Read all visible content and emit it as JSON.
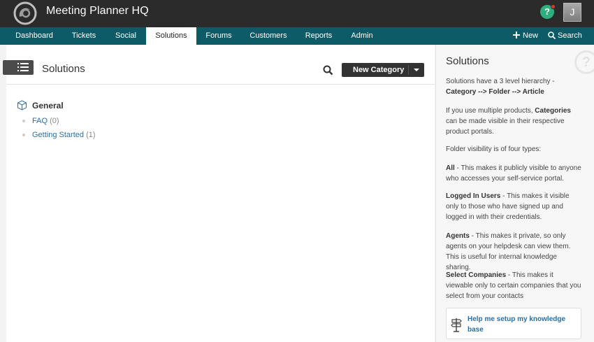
{
  "header": {
    "app_title": "Meeting Planner HQ",
    "help_label": "?",
    "avatar_initial": "J"
  },
  "nav": {
    "tabs": [
      {
        "label": "Dashboard"
      },
      {
        "label": "Tickets"
      },
      {
        "label": "Social"
      },
      {
        "label": "Solutions",
        "active": true
      },
      {
        "label": "Forums"
      },
      {
        "label": "Customers"
      },
      {
        "label": "Reports"
      },
      {
        "label": "Admin"
      }
    ],
    "new_label": "New",
    "search_label": "Search"
  },
  "main": {
    "title": "Solutions",
    "new_category_label": "New Category",
    "category": {
      "name": "General",
      "folders": [
        {
          "name": "FAQ",
          "count": "(0)"
        },
        {
          "name": "Getting Started",
          "count": "(1)"
        }
      ]
    }
  },
  "sidebar": {
    "title": "Solutions",
    "p1_pre": "Solutions have a 3 level hierarchy - ",
    "p1_bold": "Category --> Folder --> Article",
    "p2_pre": "If you use multiple products, ",
    "p2_bold": "Categories",
    "p2_post": " can be made visible in their respective product portals.",
    "p3": "Folder visibility is of four types:",
    "p4_bold": "All",
    "p4_post": " - This makes it publicly visible to anyone who accesses your self-service portal.",
    "p5_bold": "Logged In Users",
    "p5_post": " - This makes it visible only to those who have signed up and logged in with their credentials.",
    "p6_bold": "Agents",
    "p6_post": " - This makes it private, so only agents on your helpdesk can view them. This is useful for internal knowledge sharing.",
    "p7_bold": "Select Companies",
    "p7_post": " - This makes it viewable only to certain companies that you select from your contacts",
    "card_label": "Help me setup my knowledge base"
  },
  "colors": {
    "nav_bg": "#0c5b66",
    "header_bg": "#2b2b2b",
    "link": "#2a6fa6",
    "help_green": "#2eaf7f"
  }
}
